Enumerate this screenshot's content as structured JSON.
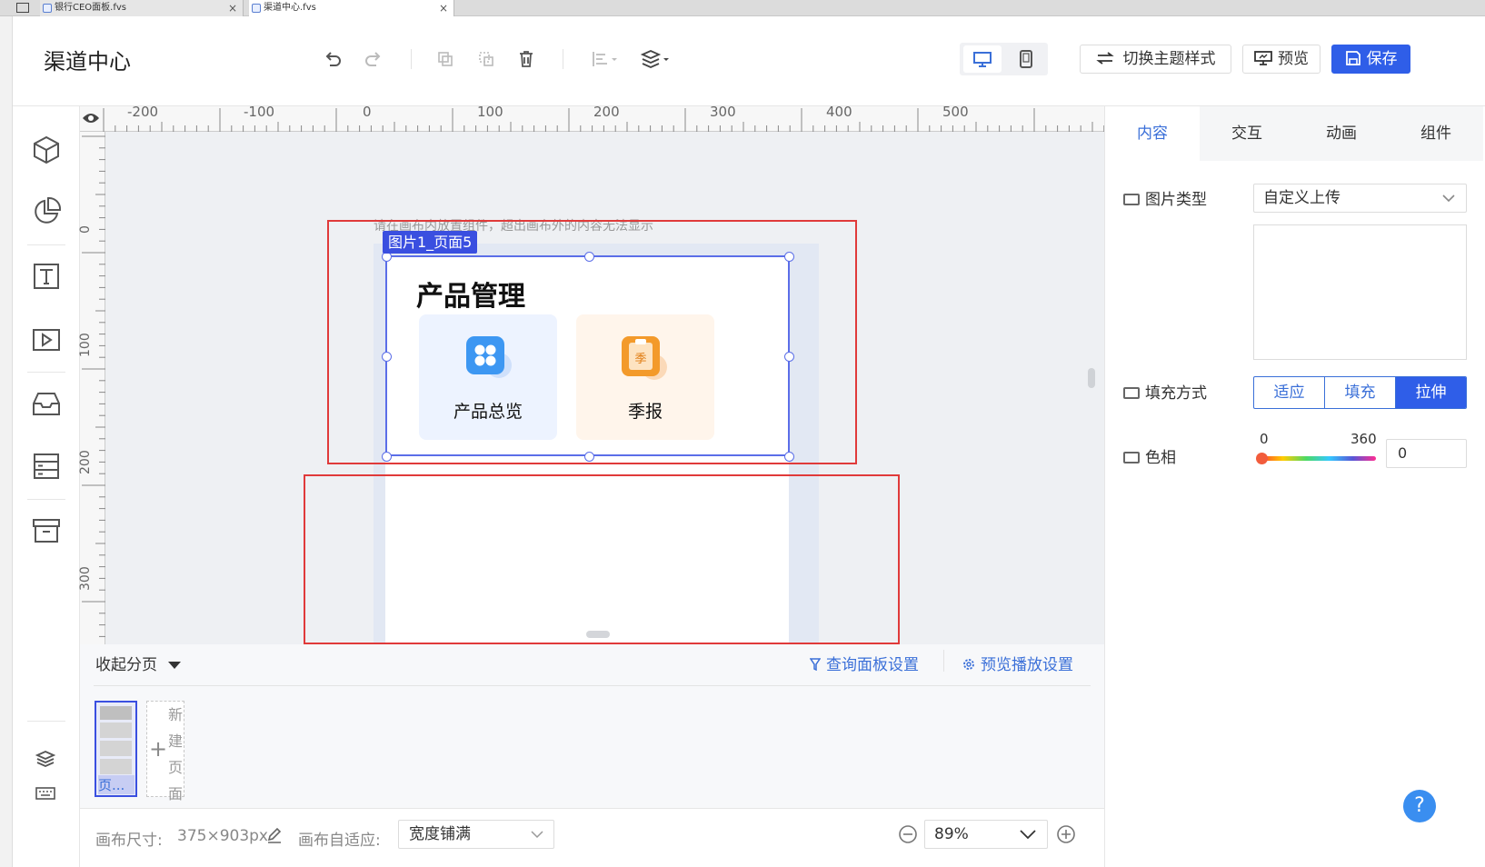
{
  "browser": {
    "tabs": [
      {
        "label": "银行CEO面板.fvs"
      },
      {
        "label": "渠道中心.fvs"
      }
    ]
  },
  "header": {
    "title": "渠道中心",
    "switch_theme_label": "切换主题样式",
    "preview_label": "预览",
    "save_label": "保存"
  },
  "ruler": {
    "h_ticks": [
      "-200",
      "-100",
      "0",
      "100",
      "200",
      "300",
      "400",
      "500"
    ],
    "v_ticks": [
      "0",
      "100",
      "200",
      "300"
    ]
  },
  "canvas": {
    "hint": "请在画布内放置组件，超出画布外的内容无法显示",
    "selected_tag": "图片1_页面5",
    "card_title": "产品管理",
    "tiles": [
      {
        "label": "产品总览",
        "icon": "grid-icon"
      },
      {
        "label": "季报",
        "icon": "clipboard-icon",
        "glyph": "季"
      }
    ]
  },
  "panel": {
    "tabs": [
      "内容",
      "交互",
      "动画",
      "组件"
    ],
    "active_tab": 0,
    "image_type_label": "图片类型",
    "image_type_value": "自定义上传",
    "fill_mode_label": "填充方式",
    "fill_modes": [
      "适应",
      "填充",
      "拉伸"
    ],
    "fill_mode_selected": 2,
    "hue_label": "色相",
    "hue_min": "0",
    "hue_max": "360",
    "hue_value": "0"
  },
  "pages": {
    "collapse_label": "收起分页",
    "query_settings_label": "查询面板设置",
    "preview_play_label": "预览播放设置",
    "thumb_label": "页...",
    "new_page_label": [
      "新",
      "建",
      "页",
      "面"
    ]
  },
  "footer": {
    "canvas_size_label": "画布尺寸:",
    "canvas_size_value": "375×903px",
    "adaptive_label": "画布自适应:",
    "adaptive_value": "宽度铺满",
    "zoom_value": "89%"
  },
  "colors": {
    "accent": "#3a6fd8",
    "save_bg": "#2f5ee8",
    "red_outline": "#e03a3a",
    "tile1_bg": "#edf3ff",
    "tile2_bg": "#fff5eb"
  }
}
